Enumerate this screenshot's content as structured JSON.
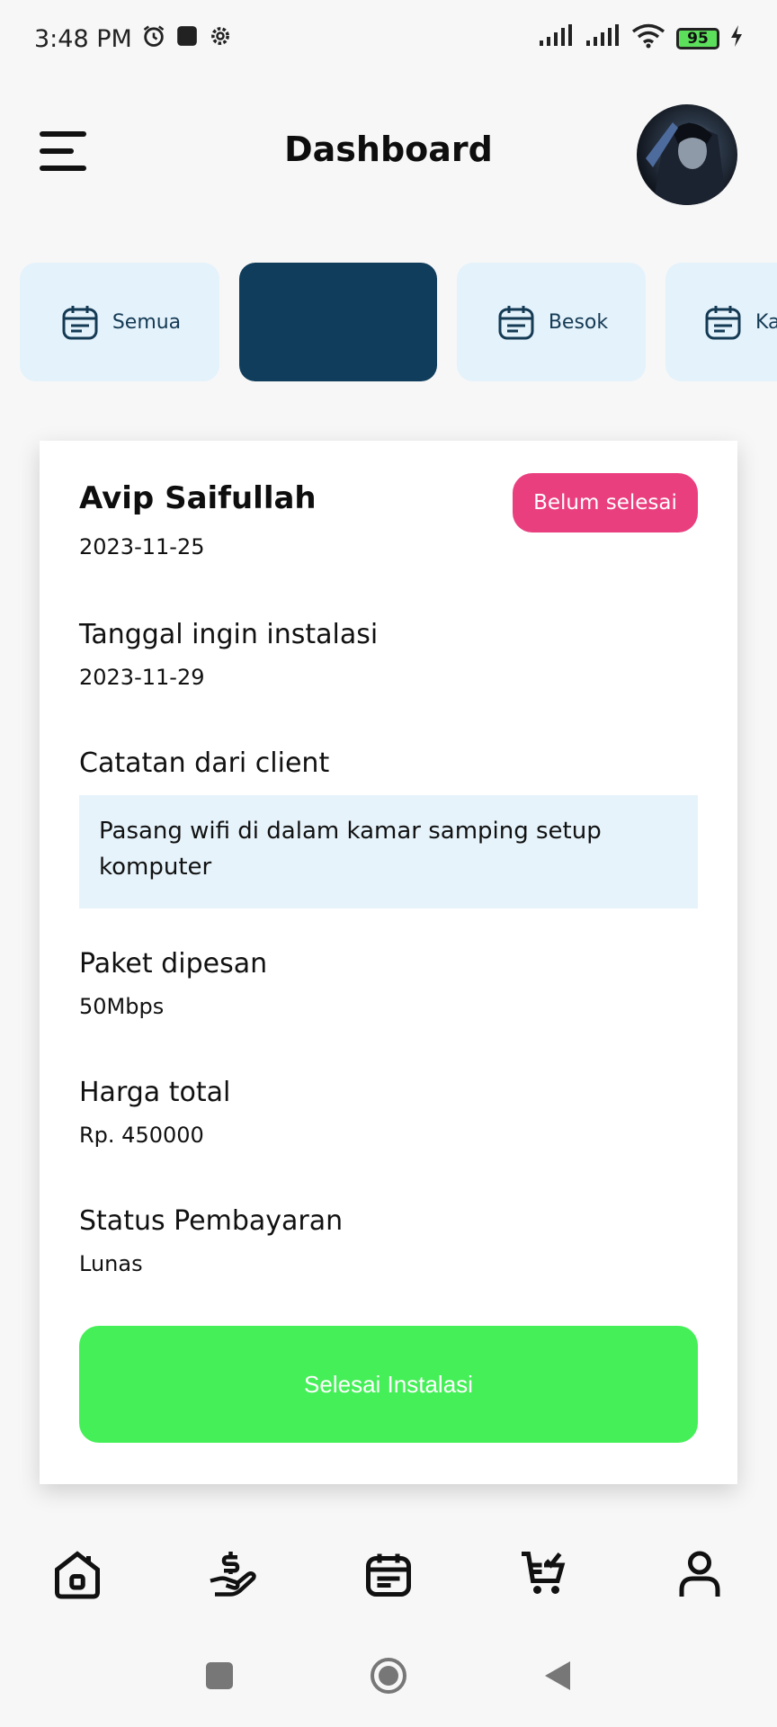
{
  "status_bar": {
    "time": "3:48 PM",
    "battery": "95"
  },
  "header": {
    "title": "Dashboard"
  },
  "tabs": [
    {
      "label": "Semua",
      "icon": "calendar-icon"
    },
    {
      "label": "",
      "icon": "",
      "active": true
    },
    {
      "label": "Besok",
      "icon": "calendar-icon"
    },
    {
      "label": "Ka",
      "icon": "calendar-icon"
    }
  ],
  "order_card": {
    "client_name": "Avip Saifullah",
    "order_date": "2023-11-25",
    "status_badge": "Belum selesai",
    "install_date_label": "Tanggal ingin instalasi",
    "install_date": "2023-11-29",
    "note_label": "Catatan dari client",
    "note": "Pasang wifi di dalam kamar samping setup komputer",
    "package_label": "Paket dipesan",
    "package": "50Mbps",
    "price_label": "Harga total",
    "price": "Rp. 450000",
    "payment_label": "Status Pembayaran",
    "payment": "Lunas",
    "finish_button": "Selesai Instalasi"
  },
  "bottom_nav": [
    "home-icon",
    "payment-icon",
    "calendar-list-icon",
    "cart-check-icon",
    "profile-icon"
  ],
  "colors": {
    "accent_dark": "#0f3d5b",
    "tab_bg": "#e4f2fb",
    "badge": "#ea3f7f",
    "button": "#45ef58",
    "note_bg": "#e6f3fb"
  }
}
